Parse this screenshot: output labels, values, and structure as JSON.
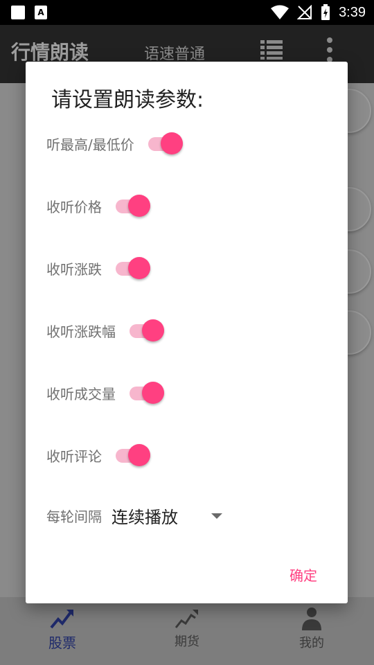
{
  "status_bar": {
    "time": "3:39"
  },
  "app_bar": {
    "title": "行情朗读",
    "speed": "语速普通"
  },
  "dialog": {
    "title": "请设置朗读参数:",
    "switches": [
      {
        "label": "听最高/最低价",
        "on": true
      },
      {
        "label": "收听价格",
        "on": true
      },
      {
        "label": "收听涨跌",
        "on": true
      },
      {
        "label": "收听涨跌幅",
        "on": true
      },
      {
        "label": "收听成交量",
        "on": true
      },
      {
        "label": "收听评论",
        "on": true
      }
    ],
    "interval_label": "每轮间隔",
    "interval_value": "连续播放",
    "confirm": "确定"
  },
  "bottom_nav": {
    "items": [
      {
        "label": "股票",
        "icon": "trend-up-icon",
        "active": true
      },
      {
        "label": "期货",
        "icon": "chart-icon",
        "active": false
      },
      {
        "label": "我的",
        "icon": "person-icon",
        "active": false
      }
    ]
  },
  "colors": {
    "accent": "#ff4081",
    "track": "#f7b6cd",
    "nav_active": "#1f2a6b"
  }
}
